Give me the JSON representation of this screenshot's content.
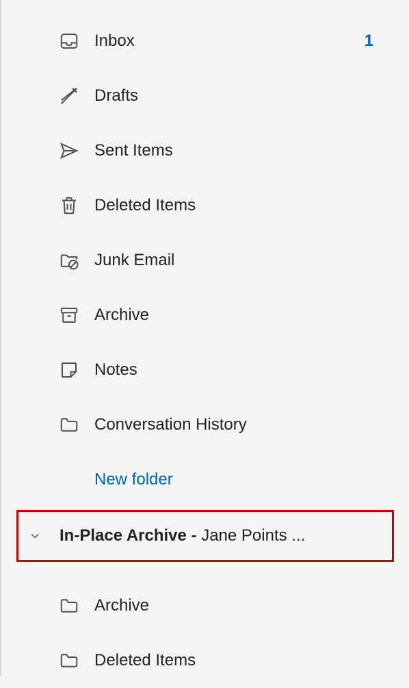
{
  "folders": {
    "inbox": {
      "label": "Inbox",
      "count": "1"
    },
    "drafts": {
      "label": "Drafts"
    },
    "sent": {
      "label": "Sent Items"
    },
    "deleted": {
      "label": "Deleted Items"
    },
    "junk": {
      "label": "Junk Email"
    },
    "archive": {
      "label": "Archive"
    },
    "notes": {
      "label": "Notes"
    },
    "conversation_history": {
      "label": "Conversation History"
    }
  },
  "new_folder_label": "New folder",
  "archive_section": {
    "title_bold": "In-Place Archive -",
    "title_normal": " Jane Points ...",
    "folders": {
      "archive": {
        "label": "Archive"
      },
      "deleted": {
        "label": "Deleted Items"
      }
    }
  }
}
